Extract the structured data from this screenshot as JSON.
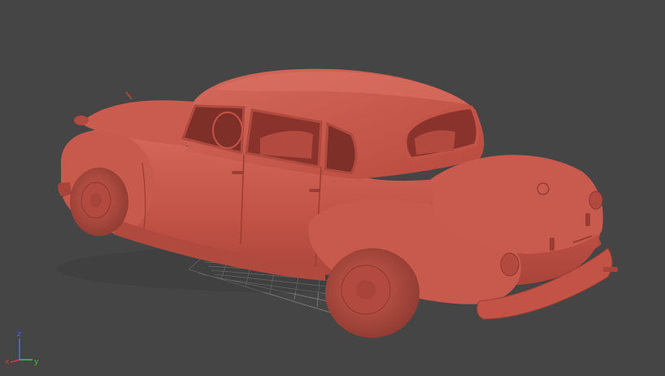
{
  "viewport": {
    "background_color": "#454545",
    "grid_color": "#8a8a8a",
    "model": {
      "icon": "car-model",
      "color": "#c35347",
      "shadow_color": "#8e3730",
      "highlight_color": "#d9675a"
    }
  },
  "axis_gizmo": {
    "x_label": "x",
    "y_label": "y",
    "z_label": "z",
    "x_color": "#d23c3c",
    "y_color": "#3cc83c",
    "z_color": "#4a6cff"
  }
}
